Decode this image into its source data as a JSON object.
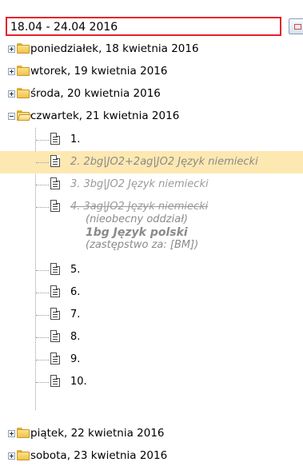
{
  "date_range": {
    "value": "18.04 - 24.04 2016"
  },
  "days": [
    {
      "label": "poniedziałek, 18 kwietnia 2016"
    },
    {
      "label": "wtorek, 19 kwietnia 2016"
    },
    {
      "label": "środa, 20 kwietnia 2016"
    },
    {
      "label": "czwartek, 21 kwietnia 2016"
    },
    {
      "label": "piątek, 22 kwietnia 2016"
    },
    {
      "label": "sobota, 23 kwietnia 2016"
    }
  ],
  "lessons": [
    {
      "label": "1."
    },
    {
      "label": "2. 2bg|JO2+2ag|JO2 Język niemiecki"
    },
    {
      "label": "3. 3bg|JO2 Język niemiecki"
    },
    {
      "label": "4. 3ag|JO2 Język niemiecki",
      "absent_note": "(nieobecny oddział)",
      "substitute_lesson": "1bg Język polski",
      "substitute_for": "(zastępstwo za: [BM])"
    },
    {
      "label": "5."
    },
    {
      "label": "6."
    },
    {
      "label": "7."
    },
    {
      "label": "8."
    },
    {
      "label": "9."
    },
    {
      "label": "10."
    }
  ],
  "colors": {
    "accent_border": "#e8202a",
    "selected_row": "#fde8b1"
  },
  "icons": {
    "folder": "folder-icon",
    "folder_open": "folder-open-icon",
    "document": "document-icon",
    "calendar": "calendar-icon"
  }
}
